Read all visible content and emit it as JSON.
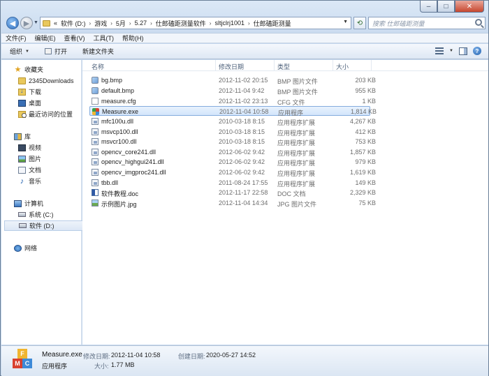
{
  "address": {
    "overflow": "«",
    "crumbs": [
      "软件 (D:)",
      "游戏",
      "5月",
      "5.27",
      "仕郎磕距测量软件",
      "sltjclrj1001",
      "仕郎磕距测量"
    ]
  },
  "search": {
    "placeholder": "搜索 仕郎磕距测量"
  },
  "menu": [
    "文件(F)",
    "编辑(E)",
    "查看(V)",
    "工具(T)",
    "帮助(H)"
  ],
  "toolbar": {
    "organize": "组织",
    "open": "打开",
    "new_folder": "新建文件夹"
  },
  "nav": {
    "favorites": {
      "title": "收藏夹",
      "items": [
        "2345Downloads",
        "下载",
        "桌面",
        "最近访问的位置"
      ]
    },
    "libraries": {
      "title": "库",
      "items": [
        "视频",
        "图片",
        "文档",
        "音乐"
      ]
    },
    "computer": {
      "title": "计算机",
      "items": [
        "系统 (C:)",
        "软件 (D:)"
      ]
    },
    "network": {
      "title": "网络"
    }
  },
  "columns": {
    "name": "名称",
    "date": "修改日期",
    "type": "类型",
    "size": "大小"
  },
  "files": [
    {
      "name": "bg.bmp",
      "date": "2012-11-02 20:15",
      "type": "BMP 图片文件",
      "size": "203 KB",
      "icon": "bmp-icon"
    },
    {
      "name": "default.bmp",
      "date": "2012-11-04 9:42",
      "type": "BMP 图片文件",
      "size": "955 KB",
      "icon": "bmp-icon"
    },
    {
      "name": "measure.cfg",
      "date": "2012-11-02 23:13",
      "type": "CFG 文件",
      "size": "1 KB",
      "icon": "cfg-icon"
    },
    {
      "name": "Measure.exe",
      "date": "2012-11-04 10:58",
      "type": "应用程序",
      "size": "1,814 KB",
      "icon": "exe-icon",
      "selected": true
    },
    {
      "name": "mfc100u.dll",
      "date": "2010-03-18 8:15",
      "type": "应用程序扩展",
      "size": "4,267 KB",
      "icon": "dll-icon"
    },
    {
      "name": "msvcp100.dll",
      "date": "2010-03-18 8:15",
      "type": "应用程序扩展",
      "size": "412 KB",
      "icon": "dll-icon"
    },
    {
      "name": "msvcr100.dll",
      "date": "2010-03-18 8:15",
      "type": "应用程序扩展",
      "size": "753 KB",
      "icon": "dll-icon"
    },
    {
      "name": "opencv_core241.dll",
      "date": "2012-06-02 9:42",
      "type": "应用程序扩展",
      "size": "1,857 KB",
      "icon": "dll-icon"
    },
    {
      "name": "opencv_highgui241.dll",
      "date": "2012-06-02 9:42",
      "type": "应用程序扩展",
      "size": "979 KB",
      "icon": "dll-icon"
    },
    {
      "name": "opencv_imgproc241.dll",
      "date": "2012-06-02 9:42",
      "type": "应用程序扩展",
      "size": "1,619 KB",
      "icon": "dll-icon"
    },
    {
      "name": "tbb.dll",
      "date": "2011-08-24 17:55",
      "type": "应用程序扩展",
      "size": "149 KB",
      "icon": "dll-icon"
    },
    {
      "name": "软件教程.doc",
      "date": "2012-11-17 22:58",
      "type": "DOC 文档",
      "size": "2,329 KB",
      "icon": "doc-icon"
    },
    {
      "name": "示例图片.jpg",
      "date": "2012-11-04 14:34",
      "type": "JPG 图片文件",
      "size": "75 KB",
      "icon": "jpg-icon"
    }
  ],
  "details": {
    "name": "Measure.exe",
    "type": "应用程序",
    "modified_label": "修改日期:",
    "modified": "2012-11-04 10:58",
    "created_label": "创建日期:",
    "created": "2020-05-27 14:52",
    "size_label": "大小:",
    "size": "1.77 MB"
  }
}
